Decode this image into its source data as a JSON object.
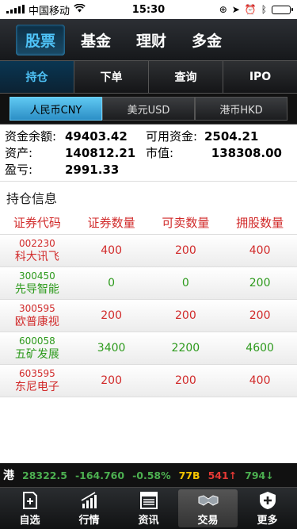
{
  "status": {
    "carrier": "中国移动",
    "time": "15:30",
    "battery_pct": 20
  },
  "top_tabs": [
    {
      "label": "股票",
      "active": true
    },
    {
      "label": "基金",
      "active": false
    },
    {
      "label": "理财",
      "active": false
    },
    {
      "label": "多金",
      "active": false
    }
  ],
  "sub_tabs": [
    {
      "label": "持仓",
      "active": true
    },
    {
      "label": "下单",
      "active": false
    },
    {
      "label": "查询",
      "active": false
    },
    {
      "label": "IPO",
      "active": false
    }
  ],
  "currency_tabs": [
    {
      "label": "人民币CNY",
      "active": true
    },
    {
      "label": "美元USD",
      "active": false
    },
    {
      "label": "港币HKD",
      "active": false
    }
  ],
  "summary": {
    "balance_label": "资金余额:",
    "balance": "49403.42",
    "available_label": "可用资金:",
    "available": "2504.21",
    "assets_label": "资产:",
    "assets": "140812.21",
    "market_value_label": "市值:",
    "market_value": "138308.00",
    "pnl_label": "盈亏:",
    "pnl": "2991.33"
  },
  "holdings_title": "持仓信息",
  "table": {
    "headers": [
      "证券代码",
      "证券数量",
      "可卖数量",
      "拥股数量"
    ],
    "rows": [
      {
        "code": "002230",
        "name": "科大讯飞",
        "qty": "400",
        "sellable": "200",
        "owned": "400",
        "color": "red"
      },
      {
        "code": "300450",
        "name": "先导智能",
        "qty": "0",
        "sellable": "0",
        "owned": "200",
        "color": "green"
      },
      {
        "code": "300595",
        "name": "欧普康视",
        "qty": "200",
        "sellable": "200",
        "owned": "200",
        "color": "red"
      },
      {
        "code": "600058",
        "name": "五矿发展",
        "qty": "3400",
        "sellable": "2200",
        "owned": "4600",
        "color": "green"
      },
      {
        "code": "603595",
        "name": "东尼电子",
        "qty": "200",
        "sellable": "200",
        "owned": "400",
        "color": "red"
      }
    ]
  },
  "ticker": {
    "market": "港",
    "index": "28322.5",
    "change": "-164.760",
    "change_pct": "-0.58%",
    "volume": "77B",
    "up_count": "541",
    "up_arrow": "↑",
    "down_count": "794",
    "down_arrow": "↓"
  },
  "tabbar": [
    {
      "label": "自选",
      "icon": "watchlist-icon",
      "active": false
    },
    {
      "label": "行情",
      "icon": "market-chart-icon",
      "active": false
    },
    {
      "label": "资讯",
      "icon": "news-icon",
      "active": false
    },
    {
      "label": "交易",
      "icon": "handshake-icon",
      "active": true
    },
    {
      "label": "更多",
      "icon": "shield-plus-icon",
      "active": false
    }
  ],
  "colors": {
    "accent": "#4fc3f7",
    "up": "#d12a2a",
    "down": "#2d9a1c"
  }
}
